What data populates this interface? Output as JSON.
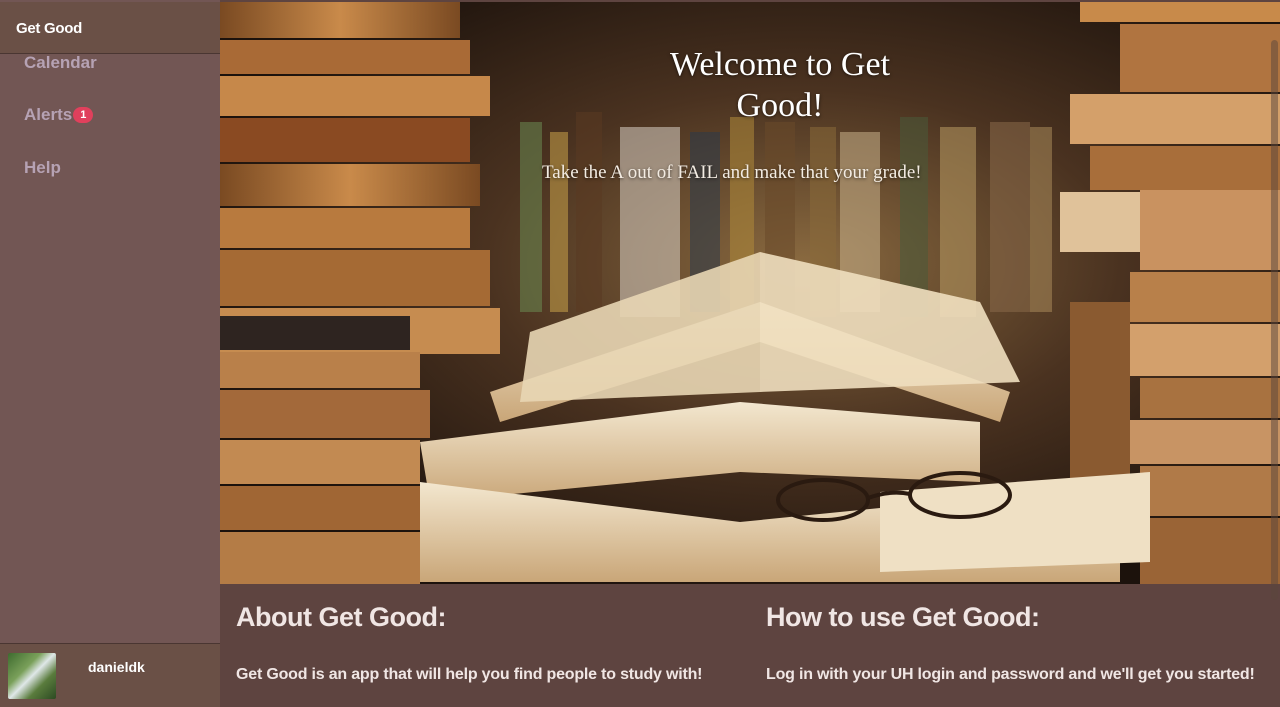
{
  "app": {
    "brand": "Get Good"
  },
  "sidebar": {
    "items": [
      {
        "label": "Calendar",
        "icon": "calendar"
      },
      {
        "label": "Alerts",
        "badge": "1",
        "icon": "bell"
      },
      {
        "label": "Help",
        "icon": "help"
      }
    ],
    "user": {
      "name": "danieldk"
    }
  },
  "hero": {
    "title": "Welcome to Get Good!",
    "subtitle": "Take the A out of FAIL and make that your grade!"
  },
  "about": {
    "title": "About Get Good:",
    "text": "Get Good is an app that will help you find people to study with!"
  },
  "howto": {
    "title": "How to use Get Good:",
    "text": "Log in with your UH login and password and we'll get you started!"
  },
  "colors": {
    "sidebar_bg": "#725654",
    "brand_bg": "#6a5046",
    "nav_text": "#b6a2b4",
    "badge": "#e0405c",
    "content_bg": "#5e4440"
  }
}
